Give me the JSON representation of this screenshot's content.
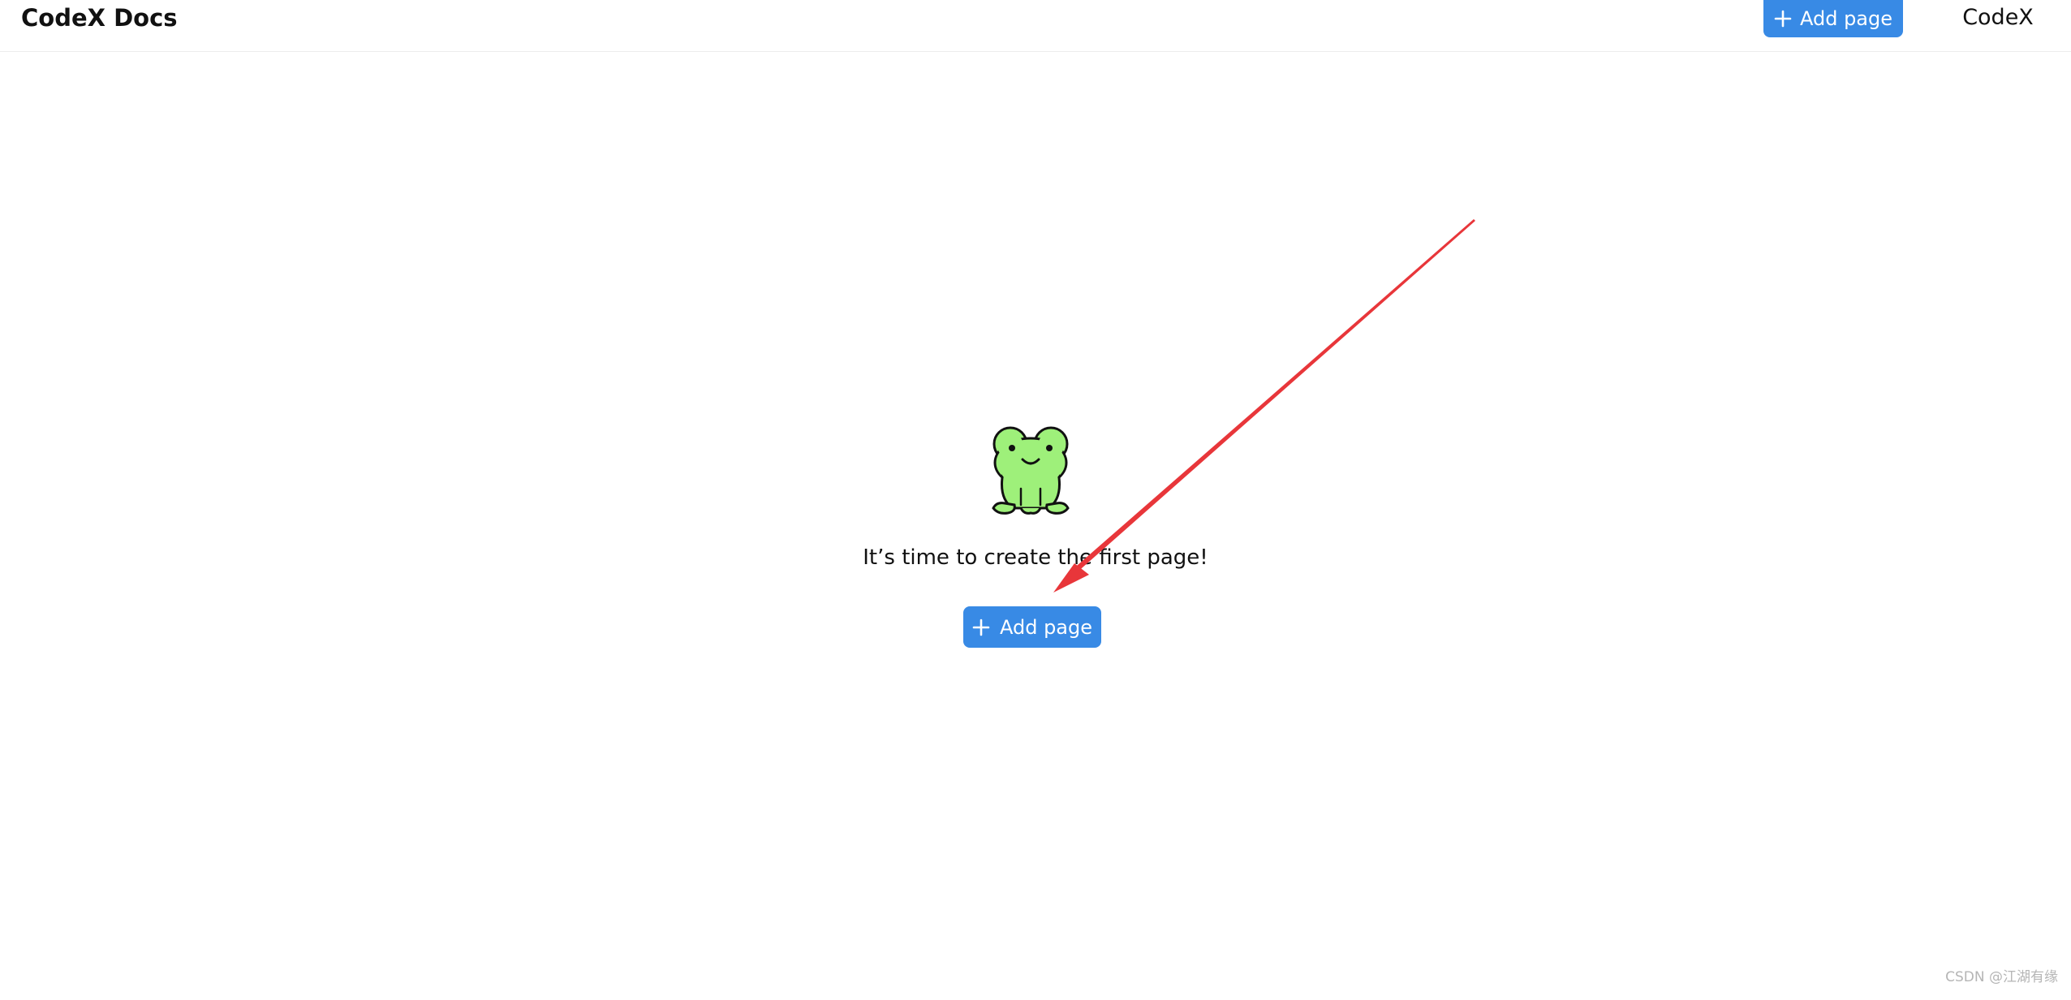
{
  "header": {
    "brand": "CodeX Docs",
    "add_page_label": "Add page",
    "user_label": "CodeX"
  },
  "empty_state": {
    "illustration_icon": "frog-icon",
    "message": "It’s time to create the first page!",
    "add_page_label": "Add page"
  },
  "icons": {
    "add": "plus-icon"
  },
  "annotation": {
    "type": "arrow",
    "color": "#e8363a",
    "points_to": "add-page-button"
  },
  "colors": {
    "accent": "#388ae5",
    "frog_body": "#9ef07a",
    "text": "#111111",
    "border": "#ececec"
  },
  "watermark": "CSDN @江湖有缘"
}
